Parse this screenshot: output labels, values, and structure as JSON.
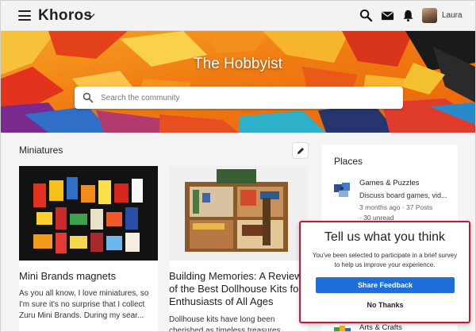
{
  "header": {
    "brand": "Khoros",
    "username": "Laura",
    "icons": [
      "menu-icon",
      "chevron-down-icon",
      "search-icon",
      "mail-icon",
      "bell-icon",
      "avatar"
    ]
  },
  "hero": {
    "title": "The Hobbyist",
    "search_placeholder": "Search the community"
  },
  "main": {
    "section_title": "Miniatures",
    "cards": [
      {
        "title": "Mini Brands magnets",
        "excerpt": "As you all know, I love miniatures, so I'm sure it's no surprise that I collect Zuru Mini Brands. During my sear..."
      },
      {
        "title": "Building Memories: A Review of the Best Dollhouse Kits for Enthusiasts of All Ages",
        "excerpt": "Dollhouse kits have long been cherished as timeless treasures."
      }
    ]
  },
  "places": {
    "title": "Places",
    "items": [
      {
        "name": "Games & Puzzles",
        "description": "Discuss board games, vid...",
        "meta": "3 months ago · 37 Posts",
        "unread": "· 30 unread"
      },
      {
        "name": "Arts & Crafts"
      }
    ]
  },
  "survey": {
    "title": "Tell us what you think",
    "body": "You've been selected to participate in a brief survey to help us improve your experience.",
    "primary_label": "Share Feedback",
    "secondary_label": "No Thanks"
  },
  "colors": {
    "primary_button": "#1e6fd9",
    "survey_border": "#d0142b",
    "hero_orange": "#f07b12"
  }
}
